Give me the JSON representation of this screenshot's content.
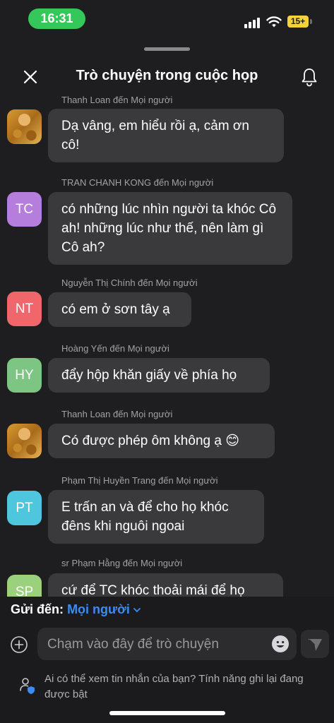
{
  "status": {
    "time": "16:31",
    "battery": "15+"
  },
  "header": {
    "title": "Trò chuyện trong cuộc họp"
  },
  "messages": [
    {
      "sender": "Thanh Loan đến Mọi người",
      "initials": "",
      "avatar_color": "#c98a2b",
      "text": "Dạ vâng, em hiểu rồi ạ, cảm ơn cô!"
    },
    {
      "sender": "TRAN CHANH KONG đến Mọi người",
      "initials": "TC",
      "avatar_color": "#b57edc",
      "text": "có những lúc nhìn người ta khóc Cô ah! những lúc như thế, nên làm gì Cô ah?"
    },
    {
      "sender": "Nguyễn Thị Chính đến Mọi người",
      "initials": "NT",
      "avatar_color": "#f0666a",
      "text": "có em ở sơn tây ạ"
    },
    {
      "sender": "Hoàng Yến đến Mọi người",
      "initials": "HY",
      "avatar_color": "#7cc583",
      "text": "đẩy hộp khăn giấy về phía họ"
    },
    {
      "sender": "Thanh Loan đến Mọi người",
      "initials": "",
      "avatar_color": "#c98a2b",
      "text": "Có được phép ôm không ạ 😊"
    },
    {
      "sender": "Phạm Thị Huyền Trang đến Mọi người",
      "initials": "PT",
      "avatar_color": "#4dc6de",
      "text": "E trấn an và để cho họ khóc đêns khi nguôi ngoai"
    },
    {
      "sender": "sr Phạm Hằng đến Mọi người",
      "initials": "SP",
      "avatar_color": "#9bd17c",
      "text": "cứ để TC khóc thoải mái để họ"
    }
  ],
  "composer": {
    "send_to_label": "Gửi đến:",
    "send_to_value": "Mọi người",
    "placeholder": "Chạm vào đây để trò chuyện"
  },
  "privacy_notice": "Ai có thể xem tin nhắn của bạn? Tính năng ghi lại đang được bật",
  "icons": [
    "close-icon",
    "bell-icon",
    "chevron-down-icon",
    "plus-circle-icon",
    "emoji-icon",
    "send-icon",
    "user-shield-icon"
  ]
}
